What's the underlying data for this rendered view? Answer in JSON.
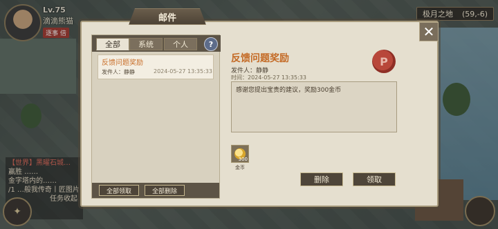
{
  "hud": {
    "level": "Lv.75",
    "player_name": "滴滴熊猫",
    "red_tag": "逐事 倍",
    "location": {
      "name": "极月之地",
      "coords": "(59,-6)"
    },
    "chat_lines": [
      "【世界】黑曜石城…",
      "赢胜 ……",
      "金字塔内的……",
      "/1 …般我传奇丨匠图片",
      "任务收起"
    ]
  },
  "mail": {
    "title": "邮件",
    "tabs": [
      "全部",
      "系统",
      "个人"
    ],
    "active_tab": "全部",
    "help_label": "?",
    "close_label": "✕",
    "list": [
      {
        "title": "反馈问题奖励",
        "sender": "发件人：静静",
        "date": "2024-05-27 13:35:33"
      }
    ],
    "claim_all_label": "全部领取",
    "delete_all_label": "全部删除",
    "detail": {
      "title": "反馈问题奖励",
      "sender": "发件人：静静",
      "time": "时间：2024-05-27 13:35:33",
      "body": "感谢您提出宝贵的建议，奖励300金币",
      "seal_letter": "P",
      "attachment": {
        "quantity": "300",
        "label": "金币"
      },
      "delete_label": "删除",
      "claim_label": "领取"
    }
  }
}
